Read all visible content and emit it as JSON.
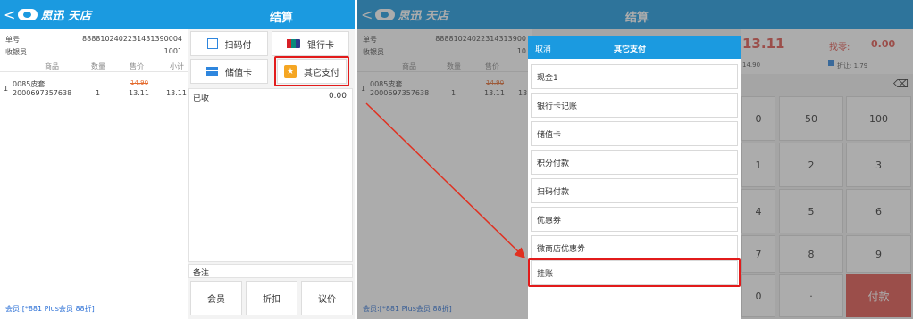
{
  "app": {
    "logo_text": "思迅 天店",
    "back_glyph": "<",
    "title": "结算"
  },
  "order": {
    "order_no_label": "单号",
    "order_no": "8888102402231431390004",
    "cashier_label": "收银员",
    "cashier": "1001"
  },
  "table": {
    "headers": [
      "商品",
      "数量",
      "售价",
      "小计"
    ],
    "row": {
      "index": "1",
      "name": "0085皮套",
      "code": "2000697357638",
      "qty": "1",
      "orig_price": "14.90",
      "price": "13.11",
      "subtotal": "13.11"
    }
  },
  "payment": {
    "scan_pay": "扫码付",
    "bank_card": "银行卡",
    "stored_card": "储值卡",
    "other_pay": "其它支付",
    "received_label": "已收",
    "received_value": "0.00",
    "remark_label": "备注"
  },
  "bottom": {
    "member": "会员",
    "discount": "折扣",
    "negotiate": "议价"
  },
  "member_info": "会员:[*881 Plus会员 88折]",
  "right_panel": {
    "order_no_partial": "88881024022314313900",
    "cashier_partial": "10",
    "amount": "13.11",
    "change_label": "找零:",
    "change_value": "0.00",
    "orig_total": "14.90",
    "discount_info": "折让: 1.79",
    "backspace_glyph": "⌫",
    "keys": [
      "50",
      "100",
      "2",
      "3",
      "5",
      "6",
      "8",
      "9",
      "0",
      "·"
    ],
    "left_keys": [
      "0",
      "1",
      "4",
      "7"
    ],
    "pay_button": "付款"
  },
  "modal": {
    "cancel": "取消",
    "title": "其它支付",
    "items": [
      "现金1",
      "银行卡记账",
      "储值卡",
      "积分付款",
      "扫码付款",
      "优惠券",
      "微商店优惠券",
      "挂账"
    ]
  },
  "colors": {
    "header_blue": "#1b9ae0",
    "highlight_red": "#e21b1b",
    "pay_red": "#e0554e",
    "arrow_red": "#e03020"
  }
}
